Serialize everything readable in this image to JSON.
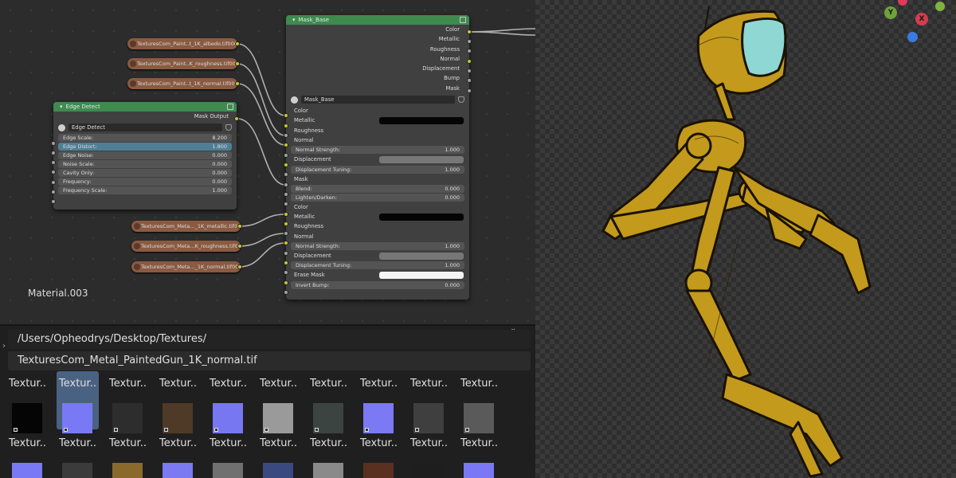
{
  "node_editor": {
    "material_name": "Material.003",
    "texture_nodes_top": [
      "TexturesCom_Paint..t_1K_albedo.tif000",
      "TexturesCom_Paint..K_roughness.tif000",
      "TexturesCom_Paint..t_1K_normal.tif000"
    ],
    "texture_nodes_bottom": [
      "TexturesCom_Meta..._1K_metallic.tif000",
      "TexturesCom_Meta...K_roughness.tif000",
      "TexturesCom_Meta..._1K_normal.tif000"
    ],
    "edge_detect": {
      "title": "Edge Detect",
      "output": "Mask Output",
      "group_name": "Edge Detect",
      "fields": [
        {
          "label": "Edge Scale:",
          "value": "8.200"
        },
        {
          "label": "Edge Distort:",
          "value": "1.800"
        },
        {
          "label": "Edge Noise:",
          "value": "0.000"
        },
        {
          "label": "Noise Scale:",
          "value": "0.000"
        },
        {
          "label": "Cavity Only:",
          "value": "0.000"
        },
        {
          "label": "Frequency:",
          "value": "0.000"
        },
        {
          "label": "Frequency Scale:",
          "value": "1.000"
        }
      ]
    },
    "mask_base": {
      "title": "Mask_Base",
      "group_name": "Mask_Base",
      "outputs": [
        "Color",
        "Metallic",
        "Roughness",
        "Normal",
        "Displacement",
        "Bump",
        "Mask"
      ],
      "inputs": {
        "color": "Color",
        "metallic": "Metallic",
        "roughness": "Roughness",
        "normal": "Normal",
        "normal_strength": {
          "label": "Normal Strength:",
          "value": "1.000"
        },
        "displacement": "Displacement",
        "displacement_tuning": {
          "label": "Displacement Tuning:",
          "value": "1.000"
        },
        "mask": "Mask",
        "blend": {
          "label": "Blend:",
          "value": "0.000"
        },
        "lighten_darken": {
          "label": "Lighten/Darken:",
          "value": "0.000"
        },
        "color2": "Color",
        "metallic2": "Metallic",
        "roughness2": "Roughness",
        "normal2": "Normal",
        "normal_strength2": {
          "label": "Normal Strength:",
          "value": "1.000"
        },
        "displacement2": "Displacement",
        "displacement_tuning2": {
          "label": "Displacement Tuning:",
          "value": "1.000"
        },
        "erase_mask": "Erase Mask",
        "invert_bump": {
          "label": "Invert Bump:",
          "value": "0.000"
        }
      }
    }
  },
  "file_browser": {
    "path": "/Users/Opheodrys/Desktop/Textures/",
    "filename": "TexturesCom_Metal_PaintedGun_1K_normal.tif",
    "tile_label": "Textur..",
    "row1_colors": [
      "#050505",
      "#7a79f5",
      "#2d2d2d",
      "#4e3a26",
      "#7877f2",
      "#9a9a9a",
      "#3c4442",
      "#7b79f4",
      "#3f3f3f",
      "#5a5a5a"
    ],
    "row2_colors": [
      "#7a79f5",
      "#3b3b3b",
      "#8a6a2c",
      "#7b7af3",
      "#707070",
      "#3a4a80",
      "#8a8a8a",
      "#5a3020",
      "#1e1e1e",
      "#7a78f4"
    ]
  },
  "viewport": {
    "gizmo_y": "Y",
    "gizmo_x": "X",
    "colors": {
      "gizmo_y": "#6fa23a",
      "gizmo_x": "#d23d50",
      "gizmo_z": "#3b7ae0",
      "robot": "#c39a1c"
    }
  }
}
